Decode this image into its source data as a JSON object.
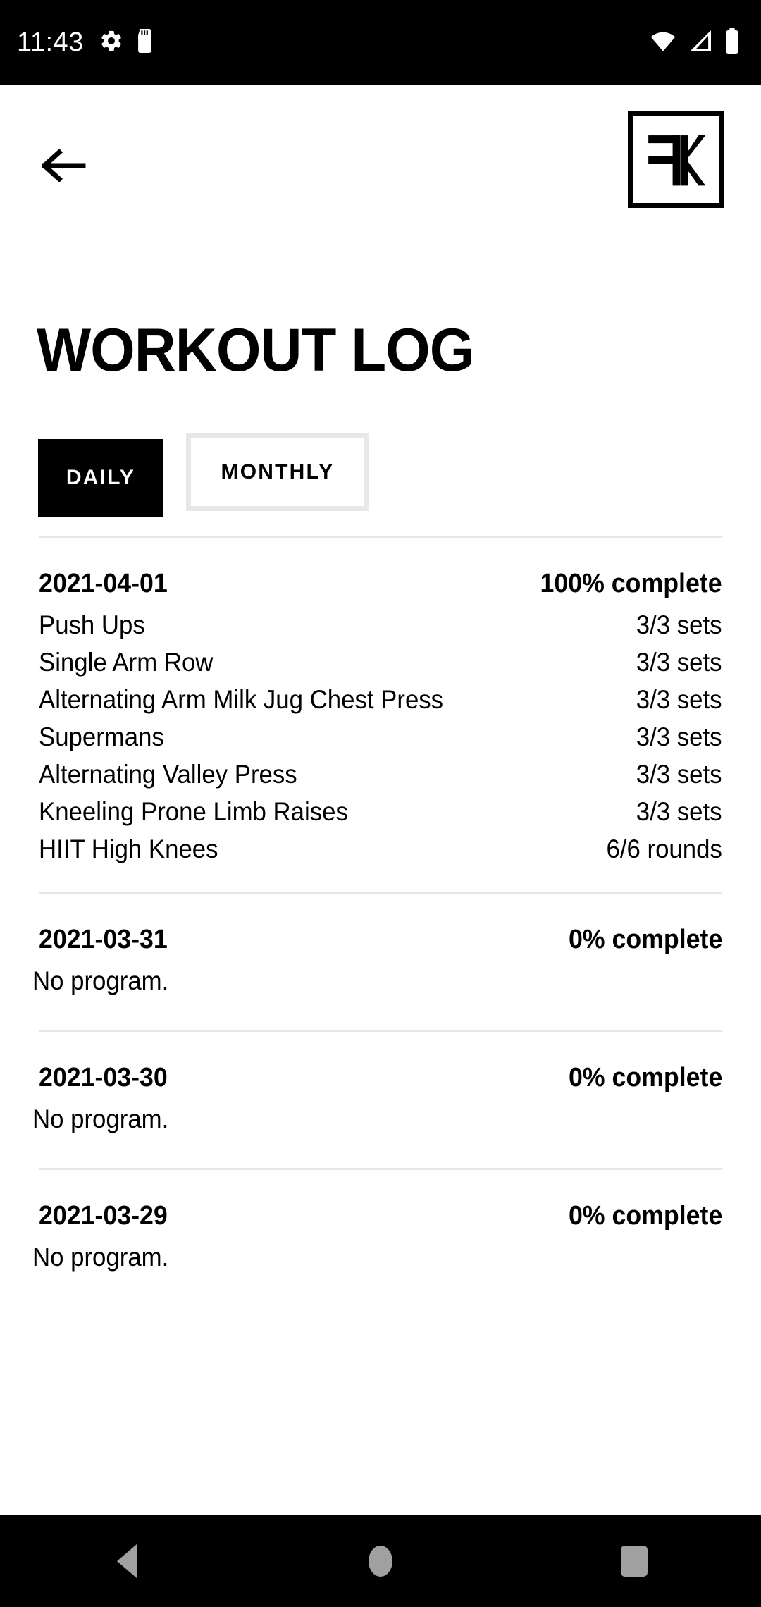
{
  "status_bar": {
    "clock": "11:43",
    "left_icons": [
      "gear-icon",
      "sd-card-icon"
    ],
    "right_icons": [
      "wifi-icon",
      "cellular-signal-icon",
      "battery-icon"
    ],
    "background": "#000000",
    "foreground": "#ffffff"
  },
  "app_bar": {
    "back_label": "Back",
    "logo_alt": "FK"
  },
  "page": {
    "title": "WORKOUT LOG"
  },
  "tabs": {
    "active": "DAILY",
    "items": [
      {
        "label": "DAILY",
        "active": true
      },
      {
        "label": "MONTHLY",
        "active": false
      }
    ]
  },
  "log": {
    "days": [
      {
        "date": "2021-04-01",
        "percent": "100% complete",
        "no_program": null,
        "exercises": [
          {
            "name": "Push Ups",
            "value": "3/3 sets"
          },
          {
            "name": "Single Arm Row",
            "value": "3/3 sets"
          },
          {
            "name": "Alternating Arm Milk Jug Chest Press",
            "value": "3/3 sets"
          },
          {
            "name": "Supermans",
            "value": "3/3 sets"
          },
          {
            "name": "Alternating Valley Press",
            "value": "3/3 sets"
          },
          {
            "name": "Kneeling Prone Limb Raises",
            "value": "3/3 sets"
          },
          {
            "name": "HIIT High Knees",
            "value": "6/6 rounds"
          }
        ]
      },
      {
        "date": "2021-03-31",
        "percent": "0% complete",
        "no_program": "No program.",
        "exercises": []
      },
      {
        "date": "2021-03-30",
        "percent": "0% complete",
        "no_program": "No program.",
        "exercises": []
      },
      {
        "date": "2021-03-29",
        "percent": "0% complete",
        "no_program": "No program.",
        "exercises": []
      }
    ]
  },
  "nav_bar": {
    "items": [
      "back-triangle-icon",
      "home-circle-icon",
      "recents-square-icon"
    ],
    "background": "#000000",
    "icon_color": "#a0a0a0"
  },
  "theme": {
    "background": "#ffffff",
    "text": "#000000",
    "accent": "#000000",
    "divider": "#e6e6e6",
    "tab_border": "#e8e8e8"
  }
}
